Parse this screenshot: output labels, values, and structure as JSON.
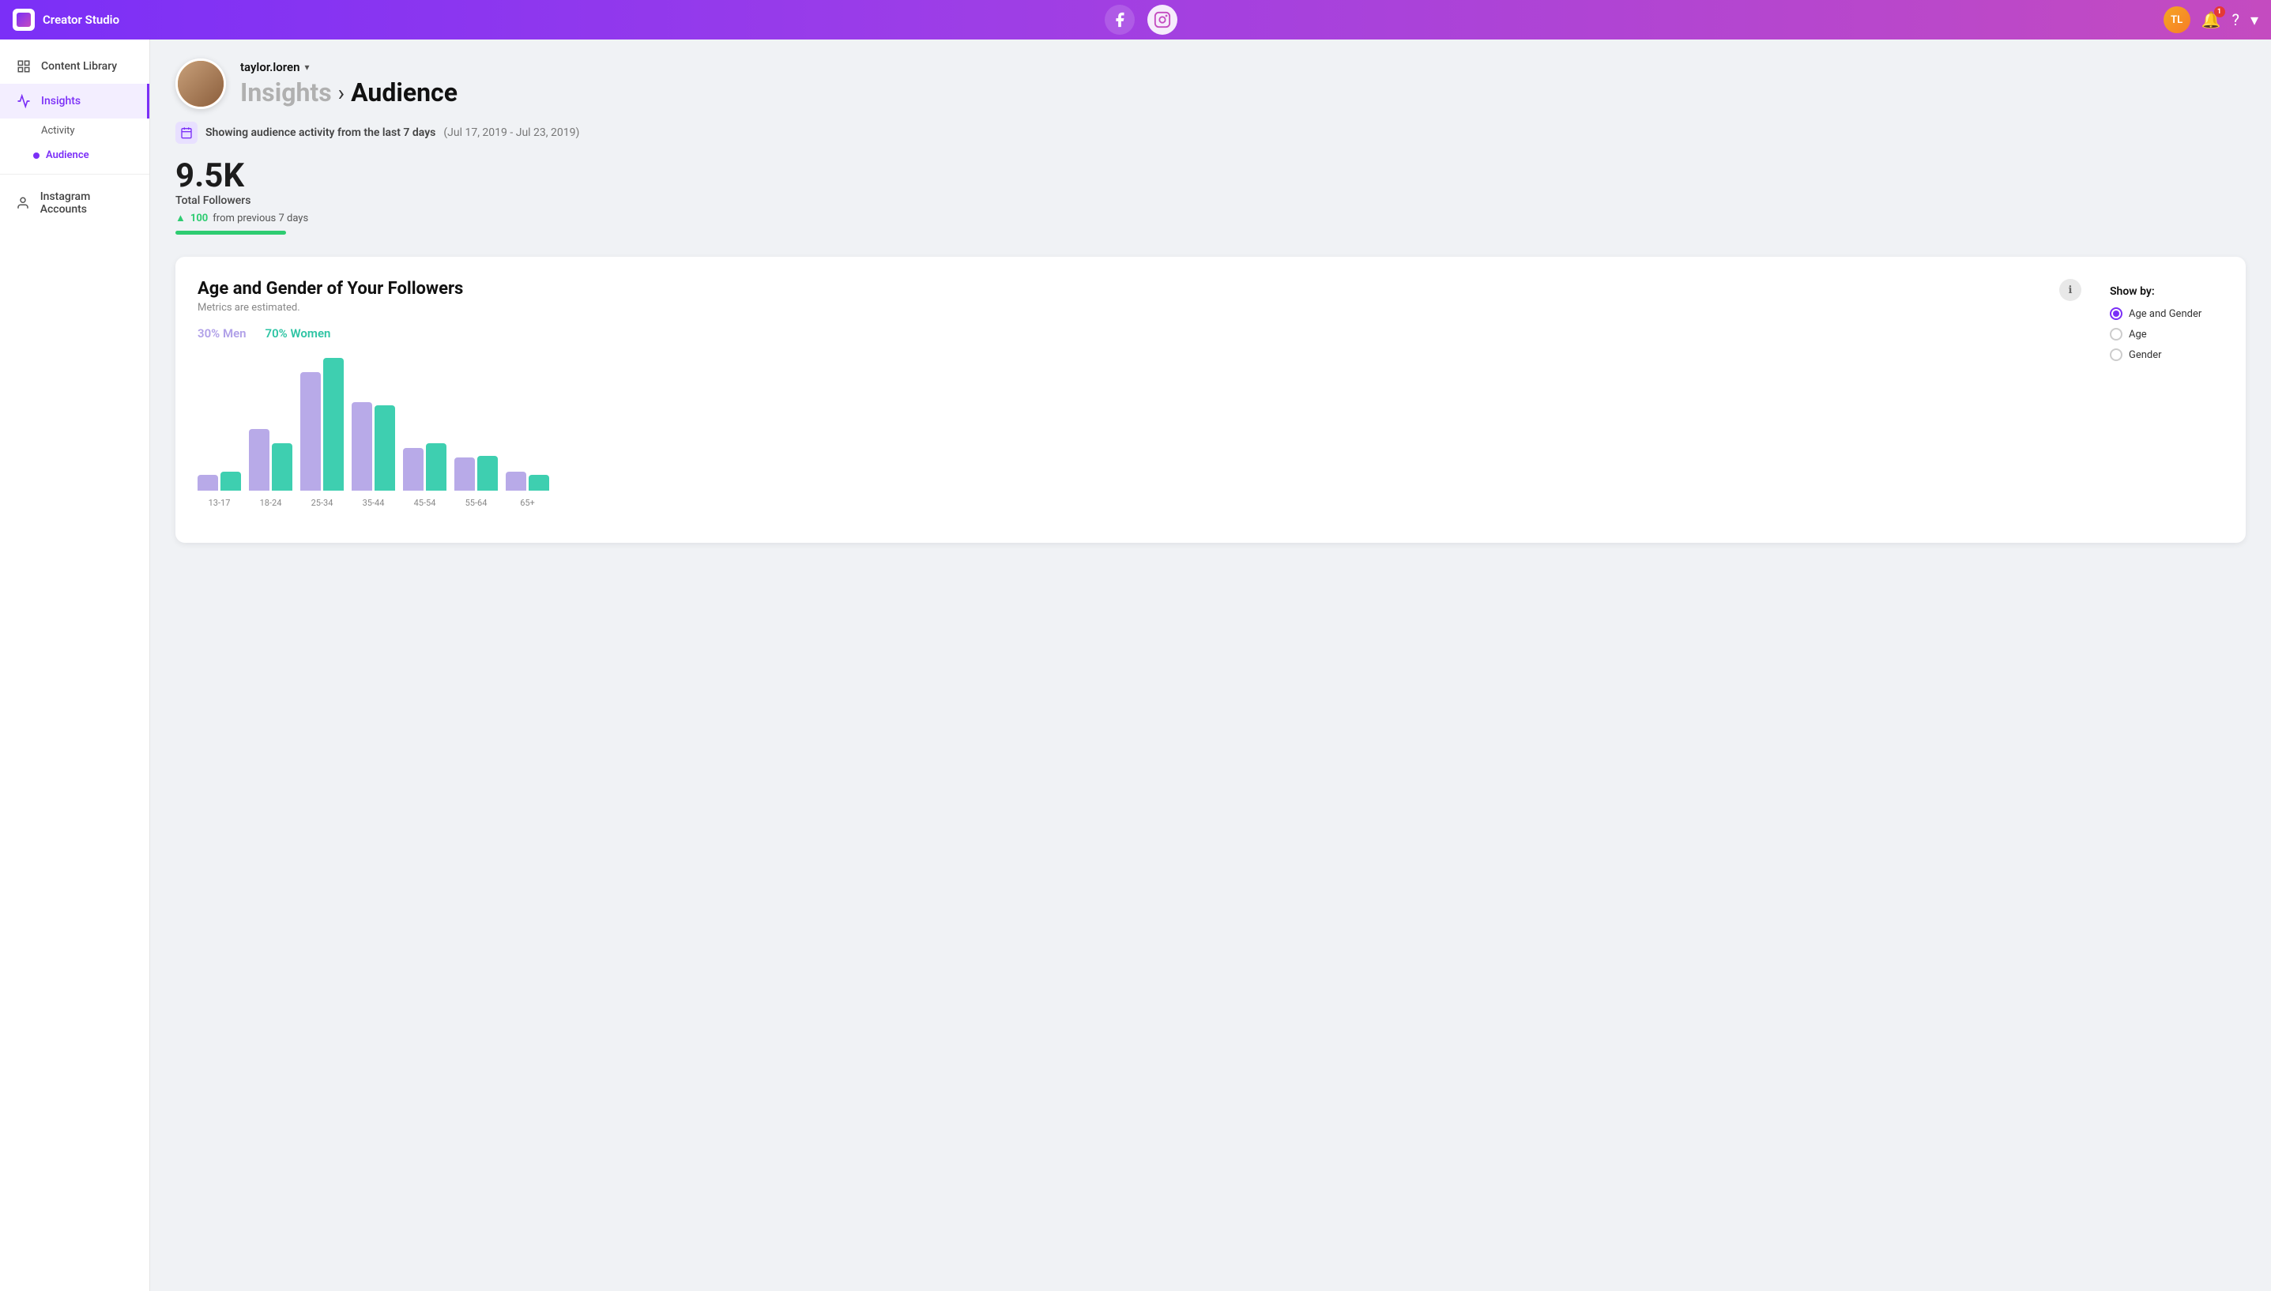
{
  "app": {
    "title": "Creator Studio",
    "logo_alt": "Creator Studio Logo"
  },
  "topnav": {
    "notification_count": "1",
    "platform_facebook": "Facebook",
    "platform_instagram": "Instagram",
    "active_platform": "instagram"
  },
  "sidebar": {
    "content_library_label": "Content Library",
    "insights_label": "Insights",
    "activity_label": "Activity",
    "audience_label": "Audience",
    "instagram_accounts_label": "Instagram Accounts"
  },
  "page": {
    "username": "taylor.loren",
    "breadcrumb_insights": "Insights",
    "breadcrumb_audience": "Audience",
    "date_banner_main": "Showing audience activity from the last 7 days",
    "date_banner_range": "(Jul 17, 2019 - Jul 23, 2019)",
    "total_followers": "9.5K",
    "total_followers_label": "Total Followers",
    "change_amount": "100",
    "change_text": "from previous 7 days"
  },
  "chart": {
    "title": "Age and Gender of Your Followers",
    "subtitle": "Metrics are estimated.",
    "men_pct": "30%",
    "men_label": "Men",
    "women_pct": "70%",
    "women_label": "Women",
    "info_icon": "ℹ",
    "show_by_title": "Show by:",
    "show_by_options": [
      {
        "id": "age-gender",
        "label": "Age and Gender",
        "selected": true
      },
      {
        "id": "age",
        "label": "Age",
        "selected": false
      },
      {
        "id": "gender",
        "label": "Gender",
        "selected": false
      }
    ],
    "bars": [
      {
        "label": "13-17",
        "men_height": 20,
        "women_height": 24
      },
      {
        "label": "18-24",
        "men_height": 78,
        "women_height": 60
      },
      {
        "label": "25-34",
        "men_height": 150,
        "women_height": 168
      },
      {
        "label": "35-44",
        "men_height": 112,
        "women_height": 108
      },
      {
        "label": "45-54",
        "men_height": 54,
        "women_height": 60
      },
      {
        "label": "55-64",
        "men_height": 42,
        "women_height": 44
      },
      {
        "label": "65+",
        "men_height": 24,
        "women_height": 20
      }
    ]
  }
}
